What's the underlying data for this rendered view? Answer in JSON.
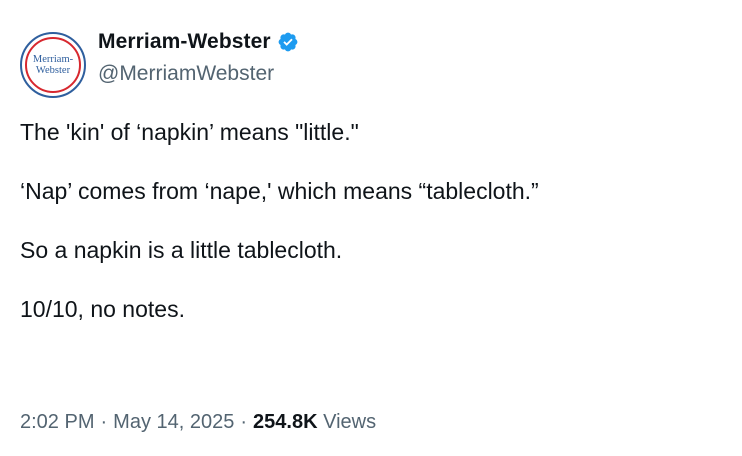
{
  "author": {
    "display_name": "Merriam-Webster",
    "handle": "@MerriamWebster",
    "avatar_text_line1": "Merriam-",
    "avatar_text_line2": "Webster",
    "verified_icon": "verified-badge-icon",
    "verified_color": "#1d9bf0"
  },
  "tweet": {
    "paragraphs": [
      "The 'kin' of ‘napkin’ means \"little.\"",
      "‘Nap’ comes from ‘nape,' which means “tablecloth.”",
      "So a napkin is a little tablecloth.",
      "10/10, no notes."
    ],
    "time": "2:02 PM",
    "date": "May 14, 2025",
    "separator": "·",
    "views_count": "254.8K",
    "views_label": "Views"
  },
  "colors": {
    "text": "#0f1419",
    "secondary": "#536471",
    "avatar_blue": "#2f5f9e",
    "avatar_red": "#d7282f"
  }
}
